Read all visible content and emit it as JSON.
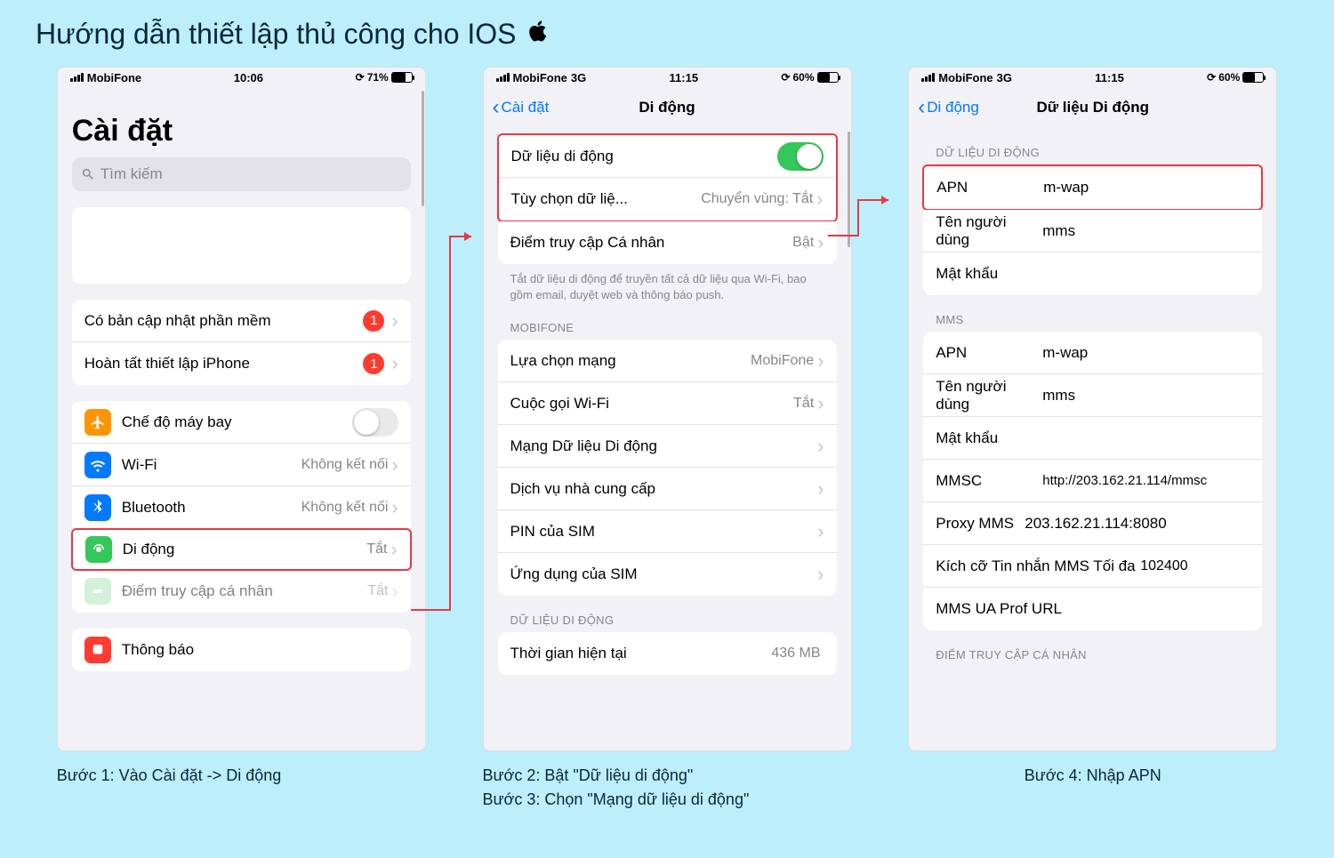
{
  "page": {
    "title": "Hướng dẫn thiết lập thủ công cho IOS"
  },
  "phone1": {
    "status": {
      "carrier": "MobiFone",
      "time": "10:06",
      "batt_pct": "71%",
      "batt_fill": 71
    },
    "title": "Cài đặt",
    "search_placeholder": "Tìm kiếm",
    "rows": {
      "update": {
        "label": "Có bản cập nhật phần mềm",
        "badge": "1"
      },
      "finish": {
        "label": "Hoàn tất thiết lập iPhone",
        "badge": "1"
      },
      "airplane": {
        "label": "Chế độ máy bay"
      },
      "wifi": {
        "label": "Wi-Fi",
        "detail": "Không kết nối"
      },
      "bluetooth": {
        "label": "Bluetooth",
        "detail": "Không kết nối"
      },
      "cellular": {
        "label": "Di động",
        "detail": "Tắt"
      },
      "hotspot": {
        "label": "Điểm truy cập cá nhân",
        "detail": "Tắt"
      },
      "notifications": {
        "label": "Thông báo"
      }
    },
    "caption": "Bước 1: Vào Cài đặt -> Di động"
  },
  "phone2": {
    "status": {
      "carrier": "MobiFone",
      "net": "3G",
      "time": "11:15",
      "batt_pct": "60%",
      "batt_fill": 60
    },
    "nav": {
      "back": "Cài đặt",
      "title": "Di động"
    },
    "rows": {
      "data": {
        "label": "Dữ liệu di động"
      },
      "options": {
        "label": "Tùy chọn dữ liệ...",
        "detail": "Chuyển vùng: Tắt"
      },
      "hotspot": {
        "label": "Điểm truy cập Cá nhân",
        "detail": "Bật"
      }
    },
    "desc": "Tắt dữ liệu di động để truyền tất cả dữ liệu qua Wi-Fi, bao gồm email, duyệt web và thông báo push.",
    "sec_mobifone": "MOBIFONE",
    "mobifone": {
      "net_select": {
        "label": "Lựa chọn mạng",
        "detail": "MobiFone"
      },
      "wifi_call": {
        "label": "Cuộc gọi Wi-Fi",
        "detail": "Tắt"
      },
      "data_net": {
        "label": "Mạng Dữ liệu Di động"
      },
      "carrier_svc": {
        "label": "Dịch vụ nhà cung cấp"
      },
      "sim_pin": {
        "label": "PIN của SIM"
      },
      "sim_apps": {
        "label": "Ứng dụng của SIM"
      }
    },
    "sec_data": "DỮ LIỆU DI ĐỘNG",
    "usage": {
      "current": {
        "label": "Thời gian hiện tại",
        "detail": "436 MB"
      }
    },
    "caption_a": "Bước 2: Bật \"Dữ liệu di động\"",
    "caption_b": "Bước 3: Chọn \"Mạng dữ liệu di động\""
  },
  "phone3": {
    "status": {
      "carrier": "MobiFone",
      "net": "3G",
      "time": "11:15",
      "batt_pct": "60%",
      "batt_fill": 60
    },
    "nav": {
      "back": "Di động",
      "title": "Dữ liệu Di động"
    },
    "sec_data": "DỮ LIỆU DI ĐỘNG",
    "data": {
      "apn": {
        "label": "APN",
        "value": "m-wap"
      },
      "user": {
        "label": "Tên người dùng",
        "value": "mms"
      },
      "pass": {
        "label": "Mật khẩu",
        "value": ""
      }
    },
    "sec_mms": "MMS",
    "mms": {
      "apn": {
        "label": "APN",
        "value": "m-wap"
      },
      "user": {
        "label": "Tên người dùng",
        "value": "mms"
      },
      "pass": {
        "label": "Mật khẩu",
        "value": ""
      },
      "mmsc": {
        "label": "MMSC",
        "value": "http://203.162.21.114/mmsc"
      },
      "proxy": {
        "label": "Proxy MMS",
        "value": "203.162.21.114:8080"
      },
      "maxsize": {
        "label": "Kích cỡ Tin nhắn MMS Tối đa",
        "value": "102400"
      },
      "uaprof": {
        "label": "MMS UA Prof URL",
        "value": ""
      }
    },
    "sec_hotspot": "ĐIỂM TRUY CẬP CÁ NHÂN",
    "caption": "Bước 4: Nhập APN"
  }
}
